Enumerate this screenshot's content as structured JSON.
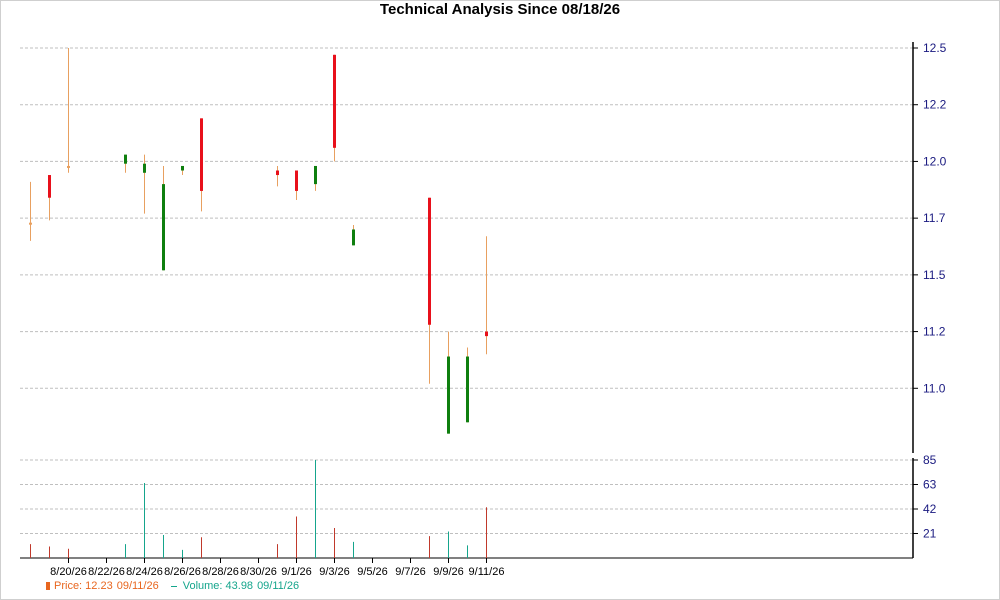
{
  "chart_data": {
    "type": "candlestick",
    "title": "Technical Analysis Since 08/18/26",
    "price_axis": {
      "ylim": [
        10.75,
        12.5
      ],
      "ticks": [
        "12.5",
        "12.2",
        "12.0",
        "11.7",
        "11.5",
        "11.2",
        "11.0"
      ],
      "tick_values": [
        12.5,
        12.25,
        12.0,
        11.75,
        11.5,
        11.25,
        11.0
      ]
    },
    "volume_axis": {
      "ylim": [
        0,
        85
      ],
      "ticks": [
        "85",
        "63",
        "42",
        "21"
      ],
      "tick_values": [
        85,
        63.75,
        42.5,
        21.25
      ]
    },
    "x_ticks": [
      "8/20/26",
      "8/22/26",
      "8/24/26",
      "8/26/26",
      "8/28/26",
      "8/30/26",
      "9/1/26",
      "9/3/26",
      "9/5/26",
      "9/7/26",
      "9/9/26",
      "9/11/26"
    ],
    "candles": [
      {
        "date": "8/18/26",
        "open": 11.73,
        "high": 11.91,
        "low": 11.65,
        "close": 11.73,
        "volume": 12
      },
      {
        "date": "8/19/26",
        "open": 11.94,
        "high": 11.94,
        "low": 11.74,
        "close": 11.84,
        "volume": 10
      },
      {
        "date": "8/20/26",
        "open": 11.98,
        "high": 12.5,
        "low": 11.95,
        "close": 11.98,
        "volume": 8
      },
      {
        "date": "8/23/26",
        "open": 11.99,
        "high": 12.03,
        "low": 11.95,
        "close": 12.03,
        "volume": 12
      },
      {
        "date": "8/24/26",
        "open": 11.95,
        "high": 12.03,
        "low": 11.77,
        "close": 11.99,
        "volume": 65
      },
      {
        "date": "8/25/26",
        "open": 11.52,
        "high": 11.98,
        "low": 11.52,
        "close": 11.9,
        "volume": 20
      },
      {
        "date": "8/26/26",
        "open": 11.96,
        "high": 11.98,
        "low": 11.94,
        "close": 11.98,
        "volume": 7
      },
      {
        "date": "8/27/26",
        "open": 12.19,
        "high": 12.19,
        "low": 11.78,
        "close": 11.87,
        "volume": 18
      },
      {
        "date": "8/31/26",
        "open": 11.96,
        "high": 11.98,
        "low": 11.89,
        "close": 11.94,
        "volume": 12
      },
      {
        "date": "9/1/26",
        "open": 11.96,
        "high": 11.96,
        "low": 11.83,
        "close": 11.87,
        "volume": 36
      },
      {
        "date": "9/2/26",
        "open": 11.9,
        "high": 11.98,
        "low": 11.87,
        "close": 11.98,
        "volume": 85
      },
      {
        "date": "9/3/26",
        "open": 12.47,
        "high": 12.47,
        "low": 12.0,
        "close": 12.06,
        "volume": 26
      },
      {
        "date": "9/4/26",
        "open": 11.63,
        "high": 11.72,
        "low": 11.63,
        "close": 11.7,
        "volume": 14
      },
      {
        "date": "9/8/26",
        "open": 11.84,
        "high": 11.84,
        "low": 11.02,
        "close": 11.28,
        "volume": 19
      },
      {
        "date": "9/9/26",
        "open": 10.8,
        "high": 11.25,
        "low": 10.8,
        "close": 11.14,
        "volume": 23
      },
      {
        "date": "9/10/26",
        "open": 10.85,
        "high": 11.18,
        "low": 10.85,
        "close": 11.14,
        "volume": 11
      },
      {
        "date": "9/11/26",
        "open": 11.25,
        "high": 11.67,
        "low": 11.15,
        "close": 11.23,
        "volume": 44
      }
    ],
    "colors": {
      "up": "#0f7f0f",
      "down": "#e8101b",
      "flat": "#e8a060",
      "volume_up": "#15a58c",
      "volume_down": "#c0392b",
      "grid": "#bfbfbf",
      "axis": "#000000"
    },
    "legend_placement": "bottom-left"
  },
  "legend": {
    "price_label": "Price: 12.23",
    "price_date": "09/11/26",
    "volume_label": "Volume: 43.98",
    "volume_date": "09/11/26",
    "price_color": "#e8661f",
    "volume_color": "#15a58c"
  }
}
